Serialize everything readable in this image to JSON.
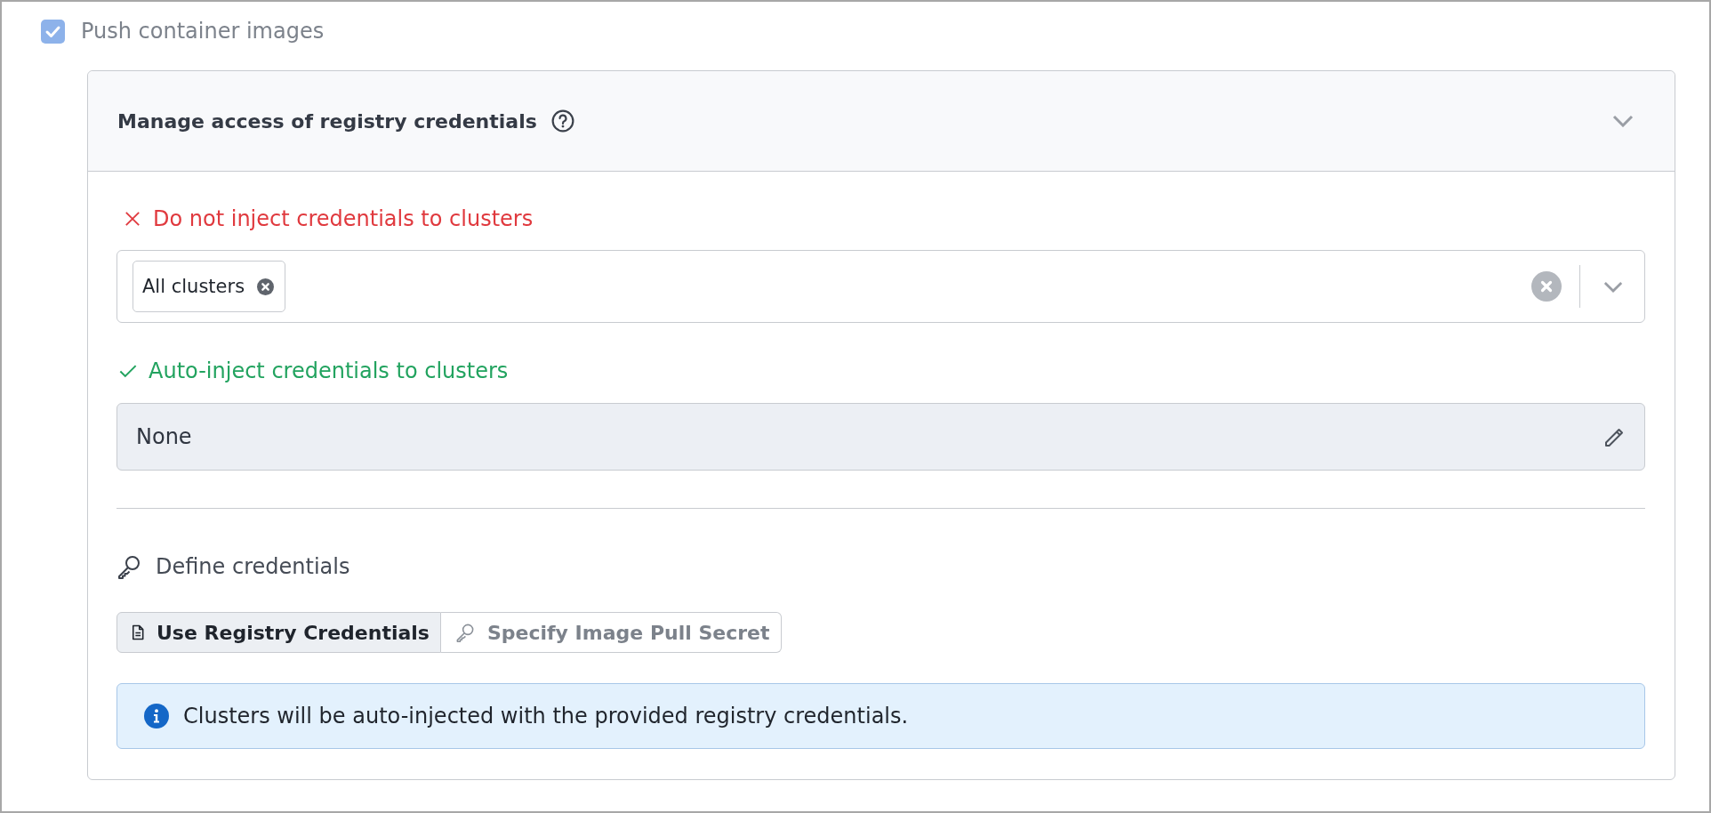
{
  "push_images": {
    "label": "Push container images",
    "checked": true
  },
  "panel": {
    "title": "Manage access of registry credentials",
    "expanded": true
  },
  "rules": [
    {
      "kind": "deny",
      "label": "Do not inject credentials to clusters",
      "field": {
        "kind": "multiselect",
        "tags": [
          "All clusters"
        ]
      }
    },
    {
      "kind": "allow",
      "label": "Auto-inject credentials to clusters",
      "field": {
        "kind": "readonly",
        "value": "None"
      }
    }
  ],
  "credentials": {
    "title": "Define credentials",
    "options": [
      {
        "label": "Use Registry Credentials",
        "selected": true
      },
      {
        "label": "Specify Image Pull Secret",
        "selected": false
      }
    ],
    "info": "Clusters will be auto-injected with the provided registry credentials."
  }
}
